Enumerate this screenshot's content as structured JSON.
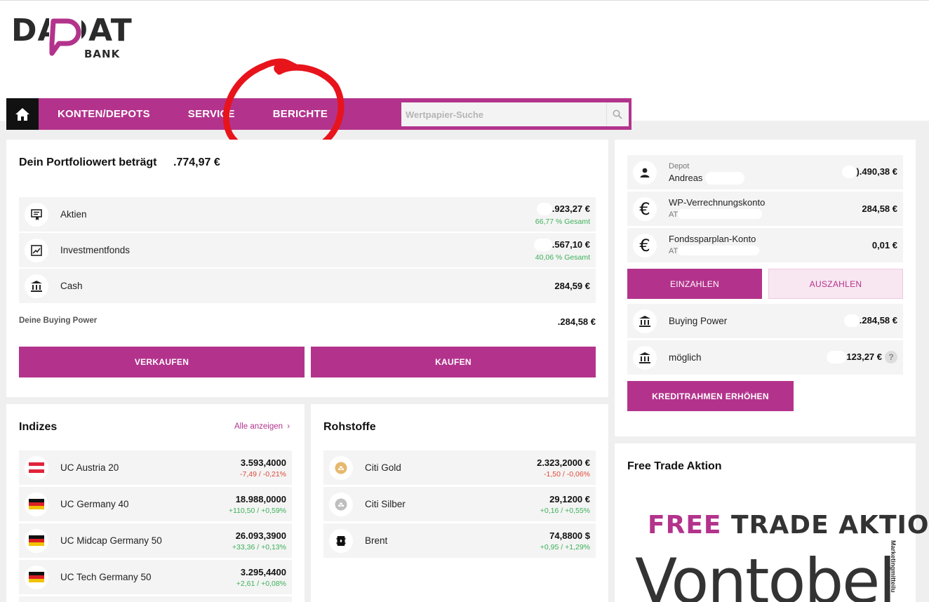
{
  "logo": {
    "text": "DADAT",
    "sub": "BANK"
  },
  "nav": {
    "home_label": "home",
    "items": [
      "KONTEN/DEPOTS",
      "SERVICE",
      "BERICHTE"
    ],
    "search_placeholder": "Wertpapier-Suche"
  },
  "portfolio": {
    "title": "Dein Portfoliowert beträgt",
    "value": ".774,97 €",
    "rows": [
      {
        "label": "Aktien",
        "amount": ".923,27 €",
        "sub": "66,77 % Gesamt"
      },
      {
        "label": "Investmentfonds",
        "amount": ".567,10 €",
        "sub": "40,06 % Gesamt"
      },
      {
        "label": "Cash",
        "amount": "284,59 €"
      }
    ],
    "buying_power_label": "Deine Buying Power",
    "buying_power_value": ".284,58 €",
    "sell_label": "VERKAUFEN",
    "buy_label": "KAUFEN"
  },
  "accounts": {
    "items": [
      {
        "small": "Depot",
        "name": "Andreas",
        "amount": ").490,38 €"
      },
      {
        "name": "WP-Verrechnungskonto",
        "small": "AT",
        "amount": "284,58 €"
      },
      {
        "name": "Fondssparplan-Konto",
        "small": "AT",
        "amount": "0,01 €"
      }
    ],
    "deposit_label": "EINZAHLEN",
    "withdraw_label": "AUSZAHLEN",
    "buying_power": {
      "label": "Buying Power",
      "amount": ".284,58 €"
    },
    "possible": {
      "label": "möglich",
      "amount": "123,27 €",
      "help": "?"
    },
    "credit_label": "KREDITRAHMEN ERHÖHEN"
  },
  "indices": {
    "title": "Indizes",
    "show_all": "Alle anzeigen",
    "items": [
      {
        "name": "UC Austria 20",
        "value": "3.593,4000",
        "change": "-7,49 / -0,21%",
        "flag": "AT",
        "direction": "down"
      },
      {
        "name": "UC Germany 40",
        "value": "18.988,0000",
        "change": "+110,50 / +0,59%",
        "flag": "DE",
        "direction": "up"
      },
      {
        "name": "UC Midcap Germany 50",
        "value": "26.093,3900",
        "change": "+33,36 / +0,13%",
        "flag": "DE",
        "direction": "up"
      },
      {
        "name": "UC Tech Germany 50",
        "value": "3.295,4400",
        "change": "+2,61 / +0,08%",
        "flag": "DE",
        "direction": "up"
      }
    ]
  },
  "commodities": {
    "title": "Rohstoffe",
    "items": [
      {
        "name": "Citi Gold",
        "value": "2.323,2000 €",
        "change": "-1,50 / -0,06%",
        "icon": "gold-bars-icon",
        "direction": "down"
      },
      {
        "name": "Citi Silber",
        "value": "29,1200 €",
        "change": "+0,16 / +0,55%",
        "icon": "silver-bars-icon",
        "direction": "up"
      },
      {
        "name": "Brent",
        "value": "74,8800 $",
        "change": "+0,95 / +1,29%",
        "icon": "oil-barrel-icon",
        "direction": "up"
      }
    ]
  },
  "promo": {
    "title": "Free Trade Aktion",
    "free": "FREE",
    "trade": "TRADE AKTION",
    "brand": "Vontobel",
    "side_text": "Marketingmitteilu"
  },
  "colors": {
    "brand": "#b3338c",
    "up": "#3cb05a",
    "down": "#e0493a",
    "annotation": "#e8141c"
  }
}
